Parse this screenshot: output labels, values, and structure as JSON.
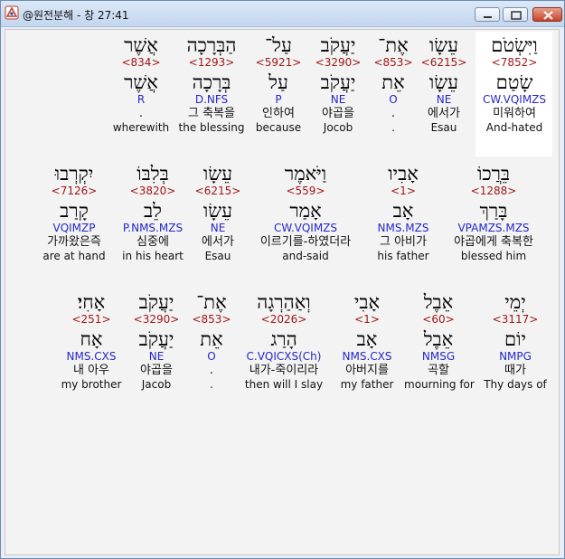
{
  "window": {
    "title": "@원전분해 - 창 27:41"
  },
  "rows": [
    [
      {
        "heb": "וַיִּשְׂטֹם",
        "num": "<7852>",
        "lemma": "שָׂטַם",
        "parse": "CW.VQIMZS",
        "kor": "미워하여",
        "eng": "And-hated"
      },
      {
        "heb": "עֵשָׂו",
        "num": "<6215>",
        "lemma": "עֵשָׂו",
        "parse": "NE",
        "kor": "에서가",
        "eng": "Esau"
      },
      {
        "heb": "אֶת־",
        "num": "<853>",
        "lemma": "אֵת",
        "parse": "O",
        "kor": ".",
        "eng": "."
      },
      {
        "heb": "יַעֲקֹב",
        "num": "<3290>",
        "lemma": "יַעֲקֹב",
        "parse": "NE",
        "kor": "야곱을",
        "eng": "Jocob"
      },
      {
        "heb": "עַל־",
        "num": "<5921>",
        "lemma": "עַל",
        "parse": "P",
        "kor": "인하여",
        "eng": "because"
      },
      {
        "heb": "הַבְּרָכָה",
        "num": "<1293>",
        "lemma": "בְּרָכָה",
        "parse": "D.NFS",
        "kor": "그 축복을",
        "eng": "the blessing"
      },
      {
        "heb": "אֲשֶׁר",
        "num": "<834>",
        "lemma": "אֲשֶׁר",
        "parse": "R",
        "kor": ".",
        "eng": "wherewith"
      }
    ],
    [
      {
        "heb": "בֵּרֲכוֹ",
        "num": "<1288>",
        "lemma": "בָּרַךְ",
        "parse": "VPAMZS.MZS",
        "kor": "야곱에게 축복한",
        "eng": "blessed him"
      },
      {
        "heb": "אָבִיו",
        "num": "<1>",
        "lemma": "אָב",
        "parse": "NMS.MZS",
        "kor": "그 아비가",
        "eng": "his father"
      },
      {
        "heb": "וַיֹּאמֶר",
        "num": "<559>",
        "lemma": "אָמַר",
        "parse": "CW.VQIMZS",
        "kor": "이르기를-하였더라",
        "eng": "and-said"
      },
      {
        "heb": "עֵשָׂו",
        "num": "<6215>",
        "lemma": "עֵשָׂו",
        "parse": "NE",
        "kor": "에서가",
        "eng": "Esau"
      },
      {
        "heb": "בְּלִבּוֹ",
        "num": "<3820>",
        "lemma": "לֵב",
        "parse": "P.NMS.MZS",
        "kor": "심중에",
        "eng": "in his heart"
      },
      {
        "heb": "יִקְרְבוּ",
        "num": "<7126>",
        "lemma": "קָרַב",
        "parse": "VQIMZP",
        "kor": "가까왔은즉",
        "eng": "are at hand"
      }
    ],
    [
      {
        "heb": "יְמֵי",
        "num": "<3117>",
        "lemma": "יוֹם",
        "parse": "NMPG",
        "kor": "때가",
        "eng": "Thy days of"
      },
      {
        "heb": "אֵבֶל",
        "num": "<60>",
        "lemma": "אֵבֶל",
        "parse": "NMSG",
        "kor": "곡할",
        "eng": "mourning for"
      },
      {
        "heb": "אָבִי",
        "num": "<1>",
        "lemma": "אָב",
        "parse": "NMS.CXS",
        "kor": "아버지를",
        "eng": "my father"
      },
      {
        "heb": "וְאַהַרְגָה",
        "num": "<2026>",
        "lemma": "הָרַג",
        "parse": "C.VQICXS(Ch)",
        "kor": "내가-죽이리라",
        "eng": "then will I slay"
      },
      {
        "heb": "אֶת־",
        "num": "<853>",
        "lemma": "אֵת",
        "parse": "O",
        "kor": ".",
        "eng": "."
      },
      {
        "heb": "יַעֲקֹב",
        "num": "<3290>",
        "lemma": "יַעֲקֹב",
        "parse": "NE",
        "kor": "야곱을",
        "eng": "Jacob"
      },
      {
        "heb": "אָחִי׃",
        "num": "<251>",
        "lemma": "אָח",
        "parse": "NMS.CXS",
        "kor": "내 아우",
        "eng": "my brother"
      }
    ]
  ]
}
